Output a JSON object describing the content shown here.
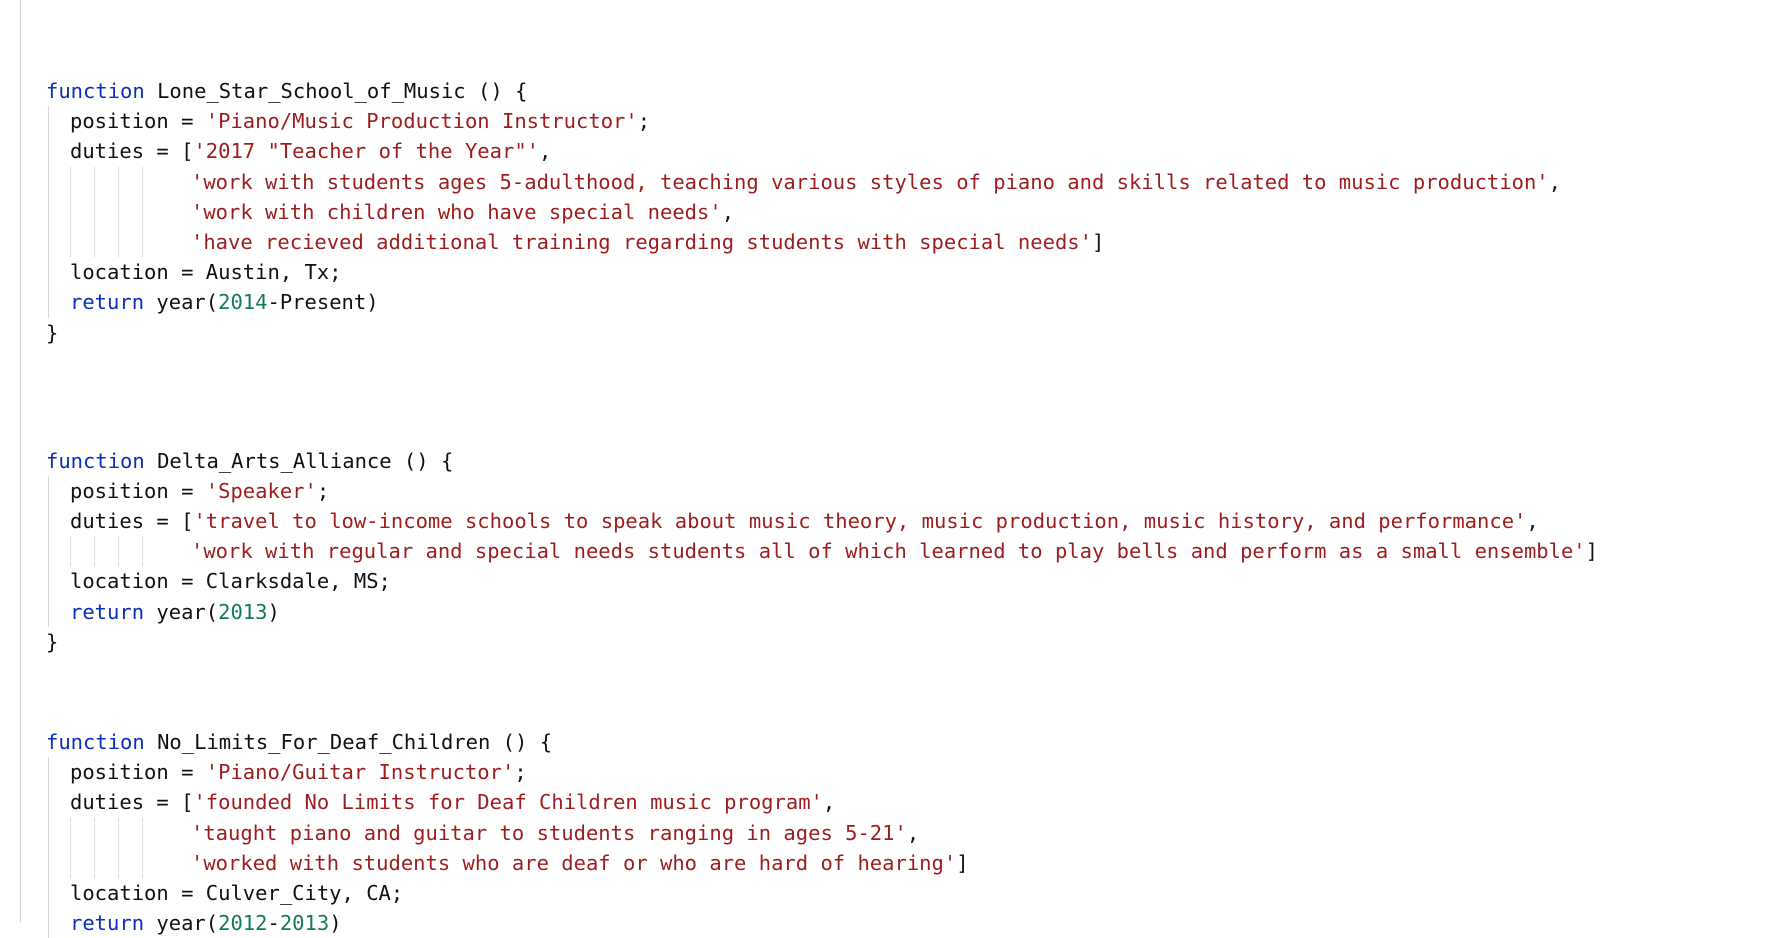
{
  "blocks": [
    {
      "keyword": "function",
      "name": "Lone_Star_School_of_Music",
      "params": " () {",
      "position_key": "position = ",
      "position_value": "'Piano/Music Production Instructor'",
      "position_end": ";",
      "duties_key": "duties = ",
      "duties": [
        {
          "prefix": "[",
          "text": "'2017 \"Teacher of the Year\"'",
          "suffix": ","
        },
        {
          "prefix": "",
          "text": "'work with students ages 5-adulthood, teaching various styles of piano and skills related to music production'",
          "suffix": ","
        },
        {
          "prefix": "",
          "text": "'work with children who have special needs'",
          "suffix": ","
        },
        {
          "prefix": "",
          "text": "'have recieved additional training regarding students with special needs'",
          "suffix": "]"
        }
      ],
      "location_key": "location = ",
      "location_value": "Austin, Tx;",
      "return_kw": "return",
      "year_fn": " year(",
      "year_start": "2014",
      "year_sep": "-",
      "year_end_plain": "Present",
      "year_close": ")",
      "closing": "}"
    },
    {
      "keyword": "function",
      "name": "Delta_Arts_Alliance",
      "params": " () {",
      "position_key": "position = ",
      "position_value": "'Speaker'",
      "position_end": ";",
      "duties_key": "duties = ",
      "duties": [
        {
          "prefix": "[",
          "text": "'travel to low-income schools to speak about music theory, music production, music history, and performance'",
          "suffix": ","
        },
        {
          "prefix": "",
          "text": "'work with regular and special needs students all of which learned to play bells and perform as a small ensemble'",
          "suffix": "]"
        }
      ],
      "location_key": "location = ",
      "location_value": "Clarksdale, MS;",
      "return_kw": "return",
      "year_fn": " year(",
      "year_start": "2013",
      "year_sep": "",
      "year_end_plain": "",
      "year_close": ")",
      "closing": "}"
    },
    {
      "keyword": "function",
      "name": "No_Limits_For_Deaf_Children",
      "params": " () {",
      "position_key": "position = ",
      "position_value": "'Piano/Guitar Instructor'",
      "position_end": ";",
      "duties_key": "duties = ",
      "duties": [
        {
          "prefix": "[",
          "text": "'founded No Limits for Deaf Children music program'",
          "suffix": ","
        },
        {
          "prefix": "",
          "text": "'taught piano and guitar to students ranging in ages 5-21'",
          "suffix": ","
        },
        {
          "prefix": "",
          "text": "'worked with students who are deaf or who are hard of hearing'",
          "suffix": "]"
        }
      ],
      "location_key": "location = ",
      "location_value": "Culver_City, CA;",
      "return_kw": "return",
      "year_fn": " year(",
      "year_start": "2012",
      "year_sep": "-",
      "year_end_num": "2013",
      "year_close": ")",
      "closing": "}"
    }
  ],
  "colors": {
    "keyword": "#0a2fb8",
    "string": "#9c1d1d",
    "number": "#137a5a",
    "text": "#111111"
  }
}
